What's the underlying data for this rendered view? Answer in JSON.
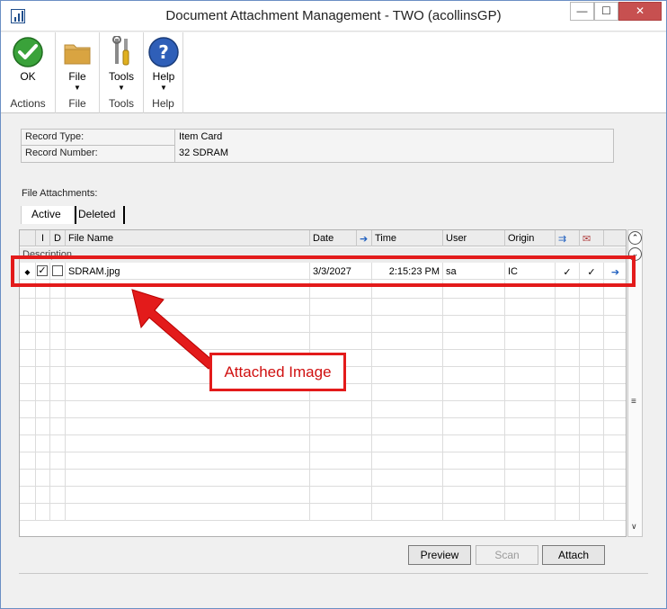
{
  "window": {
    "title": "Document Attachment Management  -  TWO (acollinsGP)",
    "controls": {
      "minimize": "—",
      "maximize": "☐",
      "close": "✕"
    }
  },
  "ribbon": {
    "groups": [
      {
        "label": "Actions",
        "buttons": [
          {
            "label": "OK",
            "icon": "ok-check-icon",
            "color": "#3aa23a"
          }
        ]
      },
      {
        "label": "File",
        "buttons": [
          {
            "label": "File",
            "icon": "folder-icon",
            "color": "#d9a441"
          }
        ]
      },
      {
        "label": "Tools",
        "buttons": [
          {
            "label": "Tools",
            "icon": "tools-icon",
            "color": "#d0a020"
          }
        ]
      },
      {
        "label": "Help",
        "buttons": [
          {
            "label": "Help",
            "icon": "help-icon",
            "color": "#2f5fb8"
          }
        ]
      }
    ]
  },
  "record": {
    "type_label": "Record Type:",
    "type_value": "Item Card",
    "number_label": "Record Number:",
    "number_value": "32 SDRAM"
  },
  "attachments": {
    "label": "File Attachments:",
    "tabs": [
      {
        "label": "Active",
        "selected": true
      },
      {
        "label": "Deleted",
        "selected": false
      }
    ],
    "columns": {
      "i": "I",
      "d": "D",
      "file_name": "File Name",
      "date": "Date",
      "time": "Time",
      "user": "User",
      "origin": "Origin"
    },
    "subheader": "Description",
    "rows": [
      {
        "marker": "◆",
        "i_checked": true,
        "d_checked": false,
        "file_name": "SDRAM.jpg",
        "date": "3/3/2027",
        "time": "2:15:23 PM",
        "user": "sa",
        "origin": "IC",
        "flag1": "✓",
        "flag2": "✓",
        "link_icon": "arrow-right-icon"
      }
    ],
    "empty_row_count": 14
  },
  "buttons": {
    "preview": "Preview",
    "scan": "Scan",
    "attach": "Attach"
  },
  "annotation": {
    "callout_text": "Attached Image",
    "color": "#e31b1b"
  }
}
